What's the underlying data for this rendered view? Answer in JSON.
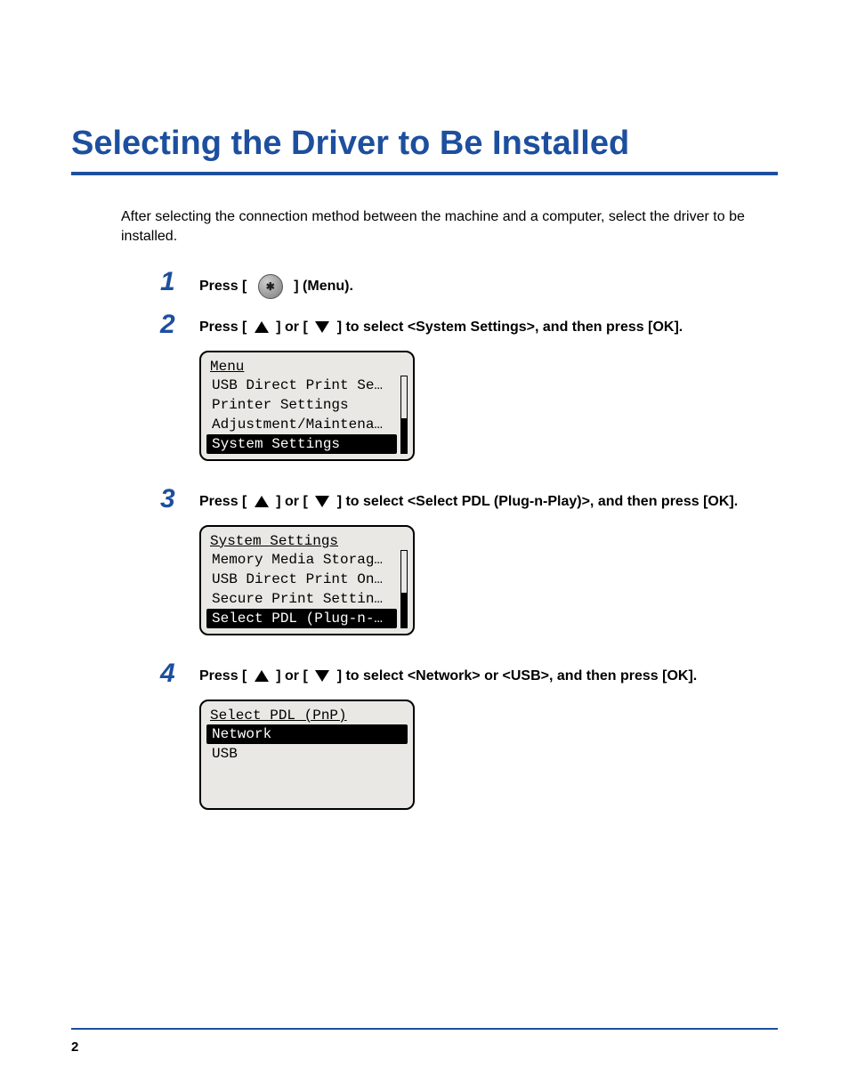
{
  "title": "Selecting the Driver to Be Installed",
  "intro": "After selecting the connection method between the machine and a computer, select the driver to be installed.",
  "steps": [
    {
      "num": "1",
      "segments": [
        "Press [ ",
        {
          "icon": "menu"
        },
        " ] (Menu)."
      ]
    },
    {
      "num": "2",
      "segments": [
        "Press [ ",
        {
          "icon": "up"
        },
        " ] or [ ",
        {
          "icon": "down"
        },
        " ] to select <System Settings>, and then press [OK]."
      ],
      "lcd": {
        "title": "Menu",
        "items": [
          "USB Direct Print Se…",
          "Printer Settings",
          "Adjustment/Maintena…",
          "System Settings"
        ],
        "selected": 3,
        "scrollbar": {
          "thumbTop": 55,
          "thumbHeight": 45
        }
      }
    },
    {
      "num": "3",
      "segments": [
        "Press [ ",
        {
          "icon": "up"
        },
        " ] or [ ",
        {
          "icon": "down"
        },
        " ] to select <Select PDL (Plug-n-Play)>, and then press [OK]."
      ],
      "lcd": {
        "title": "System Settings",
        "items": [
          "Memory Media Storag…",
          "USB Direct Print On…",
          "Secure Print Settin…",
          "Select PDL (Plug-n-…"
        ],
        "selected": 3,
        "scrollbar": {
          "thumbTop": 55,
          "thumbHeight": 45
        }
      }
    },
    {
      "num": "4",
      "segments": [
        "Press [ ",
        {
          "icon": "up"
        },
        " ] or [ ",
        {
          "icon": "down"
        },
        " ] to select <Network> or <USB>, and then press [OK]."
      ],
      "lcd": {
        "title": "Select PDL (PnP)",
        "items": [
          "Network",
          "USB",
          " ",
          " "
        ],
        "selected": 0,
        "scrollbar": null
      }
    }
  ],
  "page_number": "2"
}
